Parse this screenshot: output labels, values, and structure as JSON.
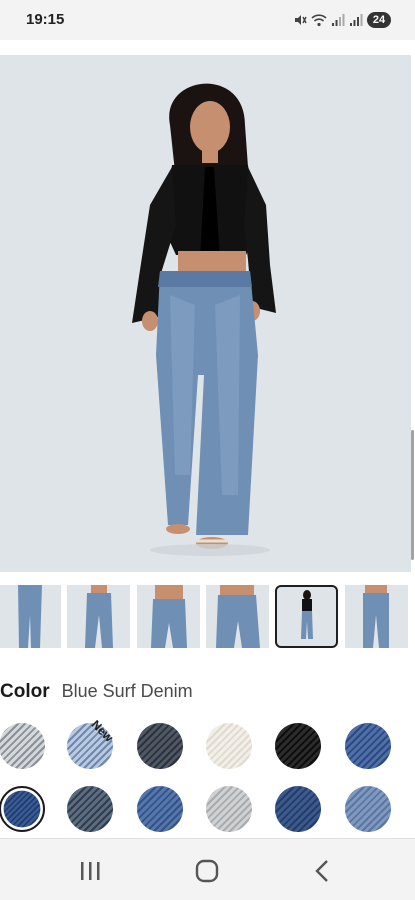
{
  "status_bar": {
    "time": "19:15",
    "battery": "24",
    "icons": [
      "mute-icon",
      "wifi-icon",
      "signal-icon",
      "signal-icon",
      "battery-icon"
    ]
  },
  "product": {
    "image_alt": "Model wearing low rise wide leg jeans and black ruffle top",
    "hero_background": "#dfe4e8"
  },
  "thumbnails": [
    {
      "label": "thumb-1"
    },
    {
      "label": "thumb-2"
    },
    {
      "label": "thumb-3"
    },
    {
      "label": "thumb-4"
    },
    {
      "label": "thumb-5"
    },
    {
      "label": "thumb-6"
    }
  ],
  "color_section": {
    "label": "Color",
    "selected_name": "Blue Surf Denim",
    "new_badge": "New"
  },
  "swatches": [
    {
      "name": "light-white-denim",
      "color": "#d4d7db",
      "stripe": "#8a9096"
    },
    {
      "name": "light-blue-denim",
      "color": "#b9c9e0",
      "stripe": "#6f87ad"
    },
    {
      "name": "dark-grey-denim",
      "color": "#505866",
      "stripe": "#2c323b"
    },
    {
      "name": "ecru-denim",
      "color": "#f2efe8",
      "stripe": "#dedad0"
    },
    {
      "name": "black-denim",
      "color": "#2b2b2b",
      "stripe": "#0d0d0d"
    },
    {
      "name": "mid-blue-denim",
      "color": "#4f6fa8",
      "stripe": "#2c4a80"
    },
    {
      "name": "blue-surf-denim",
      "color": "#3a5a92",
      "stripe": "#1f3a6e"
    },
    {
      "name": "slate-denim",
      "color": "#5c6d80",
      "stripe": "#2f3d4e"
    },
    {
      "name": "medium-denim",
      "color": "#5577ad",
      "stripe": "#345283"
    },
    {
      "name": "grey-wash-denim",
      "color": "#cfd1d3",
      "stripe": "#a9acaf"
    },
    {
      "name": "navy-denim",
      "color": "#3d5a8e",
      "stripe": "#233c68"
    },
    {
      "name": "pale-blue-denim",
      "color": "#7f99c1",
      "stripe": "#5a76a1"
    }
  ],
  "nav": {
    "recents": "recents-icon",
    "home": "home-icon",
    "back": "back-icon"
  }
}
